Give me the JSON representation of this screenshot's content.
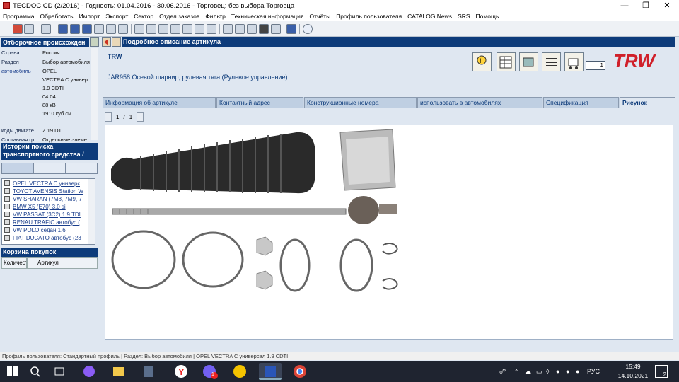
{
  "window": {
    "title": "TECDOC CD (2/2016)  -  Годность: 01.04.2016 - 30.06.2016  -  Торговец: без выбора Торговца",
    "controls": [
      "—",
      "❐",
      "✕"
    ]
  },
  "menu": [
    "Программа",
    "Обработать",
    "Импорт",
    "Экспорт",
    "Сектор",
    "Отдел заказов",
    "Фильтр",
    "Техническая информация",
    "Отчёты",
    "Профиль пользователя",
    "CATALOG News",
    "SRS",
    "Помощь"
  ],
  "left": {
    "origin_header": "Отборочное происхожден",
    "origin_rows": [
      {
        "key": "Страна",
        "value": "Россия"
      },
      {
        "key": "Раздел",
        "value": "Выбор автомобиля"
      },
      {
        "key": "автомобиль",
        "value": "OPEL"
      },
      {
        "key": "",
        "value": "VECTRA C универ"
      },
      {
        "key": "",
        "value": "1.9 CDTI"
      },
      {
        "key": "",
        "value": "04.04"
      },
      {
        "key": "",
        "value": "88 кВ"
      },
      {
        "key": "",
        "value": "1910 куб.см"
      },
      {
        "key": "коды двигате",
        "value": "Z 19 DT"
      },
      {
        "key": "Составная гр",
        "value": "Отдельные элеме"
      }
    ],
    "history_header": "Истории поиска транспортного средства /",
    "history_items": [
      "OPEL VECTRA C универс",
      "TOYOT AVENSIS Station W",
      "VW SHARAN (7M8, 7M9, 7",
      "BMW X5 (E70) 3.0 si",
      "VW PASSAT (3C2) 1.9 TDI",
      "RENAU TRAFIC автобус (",
      "VW POLO седан 1.6",
      "FIAT DUCATO автобус (23"
    ],
    "cart_header": "Корзина покупок",
    "cart_columns": [
      "Количест",
      "Артикул"
    ]
  },
  "detail": {
    "header": "Подробное описание артикула",
    "brand": "TRW",
    "description": "JAR958 Осевой шарнир, рулевая тяга (Рулевое управление)",
    "quantity": "1",
    "logo_text": "TRW",
    "tabs": [
      "Информация об артикуле",
      "Контактный адрес",
      "Конструкционные номера",
      "использовать в автомобилях",
      "Спецификация",
      "Рисунок"
    ],
    "active_tab": "Рисунок",
    "pager": {
      "current": "1",
      "separator": "/",
      "total": "1"
    }
  },
  "status": "Профиль пользователя: Стандартный профиль | Раздел: Выбор автомобиля | OPEL VECTRA C универсал 1.9 CDTI",
  "taskbar": {
    "language": "РУС",
    "time": "15:49",
    "date": "14.10.2021",
    "notifications": "2",
    "vpn_badge": "1"
  },
  "colors": {
    "header_blue": "#0d3b7a",
    "panel_bg": "#dfe7f1",
    "trw_red": "#d0202a"
  }
}
